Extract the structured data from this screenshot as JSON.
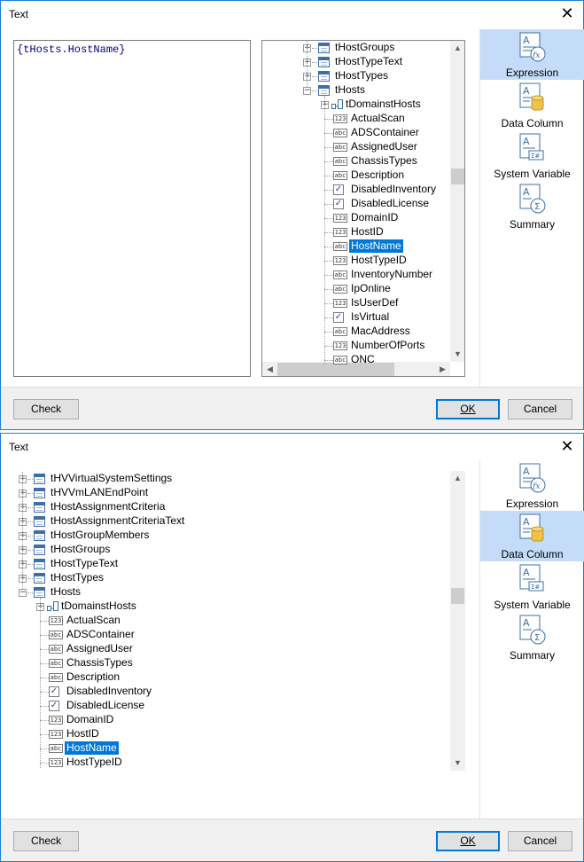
{
  "dialog1": {
    "title": "Text",
    "expression": "{tHosts.HostName}",
    "tree": [
      {
        "label": "tHostGroups",
        "kind": "table",
        "expanded": false
      },
      {
        "label": "tHostTypeText",
        "kind": "table",
        "expanded": false
      },
      {
        "label": "tHostTypes",
        "kind": "table",
        "expanded": false
      },
      {
        "label": "tHosts",
        "kind": "table",
        "expanded": true
      },
      {
        "label": "tDomainstHosts",
        "kind": "relation",
        "expanded": false
      },
      {
        "label": "ActualScan",
        "kind": "num"
      },
      {
        "label": "ADSContainer",
        "kind": "abc"
      },
      {
        "label": "AssignedUser",
        "kind": "abc"
      },
      {
        "label": "ChassisTypes",
        "kind": "abc"
      },
      {
        "label": "Description",
        "kind": "abc"
      },
      {
        "label": "DisabledInventory",
        "kind": "bool"
      },
      {
        "label": "DisabledLicense",
        "kind": "bool"
      },
      {
        "label": "DomainID",
        "kind": "num"
      },
      {
        "label": "HostID",
        "kind": "num"
      },
      {
        "label": "HostName",
        "kind": "abc",
        "selected": true
      },
      {
        "label": "HostTypeID",
        "kind": "num"
      },
      {
        "label": "InventoryNumber",
        "kind": "abc"
      },
      {
        "label": "IpOnline",
        "kind": "abc"
      },
      {
        "label": "IsUserDef",
        "kind": "num"
      },
      {
        "label": "IsVirtual",
        "kind": "bool"
      },
      {
        "label": "MacAddress",
        "kind": "abc"
      },
      {
        "label": "NumberOfPorts",
        "kind": "num"
      },
      {
        "label": "ONC",
        "kind": "abc"
      }
    ],
    "check_label": "Check",
    "ok_label": "OK",
    "cancel_label": "Cancel"
  },
  "dialog2": {
    "title": "Text",
    "tree": [
      {
        "label": "tHVVirtualSystemSettings",
        "kind": "table",
        "expanded": false
      },
      {
        "label": "tHVVmLANEndPoint",
        "kind": "table",
        "expanded": false
      },
      {
        "label": "tHostAssignmentCriteria",
        "kind": "table",
        "expanded": false
      },
      {
        "label": "tHostAssignmentCriteriaText",
        "kind": "table",
        "expanded": false
      },
      {
        "label": "tHostGroupMembers",
        "kind": "table",
        "expanded": false
      },
      {
        "label": "tHostGroups",
        "kind": "table",
        "expanded": false
      },
      {
        "label": "tHostTypeText",
        "kind": "table",
        "expanded": false
      },
      {
        "label": "tHostTypes",
        "kind": "table",
        "expanded": false
      },
      {
        "label": "tHosts",
        "kind": "table",
        "expanded": true
      },
      {
        "label": "tDomainstHosts",
        "kind": "relation",
        "expanded": false
      },
      {
        "label": "ActualScan",
        "kind": "num"
      },
      {
        "label": "ADSContainer",
        "kind": "abc"
      },
      {
        "label": "AssignedUser",
        "kind": "abc"
      },
      {
        "label": "ChassisTypes",
        "kind": "abc"
      },
      {
        "label": "Description",
        "kind": "abc"
      },
      {
        "label": "DisabledInventory",
        "kind": "bool"
      },
      {
        "label": "DisabledLicense",
        "kind": "bool"
      },
      {
        "label": "DomainID",
        "kind": "num"
      },
      {
        "label": "HostID",
        "kind": "num"
      },
      {
        "label": "HostName",
        "kind": "abc",
        "selected": true
      },
      {
        "label": "HostTypeID",
        "kind": "num"
      }
    ],
    "check_label": "Check",
    "ok_label": "OK",
    "cancel_label": "Cancel"
  },
  "side_buttons": [
    {
      "label": "Expression",
      "icon": "expression-icon"
    },
    {
      "label": "Data Column",
      "icon": "data-column-icon"
    },
    {
      "label": "System Variable",
      "icon": "system-variable-icon"
    },
    {
      "label": "Summary",
      "icon": "summary-icon"
    }
  ],
  "dialog1_active_side": 0,
  "dialog2_active_side": 1,
  "colors": {
    "accent": "#0078d7",
    "side_active": "#c4dcf7",
    "frame": "#1e7fd2"
  }
}
